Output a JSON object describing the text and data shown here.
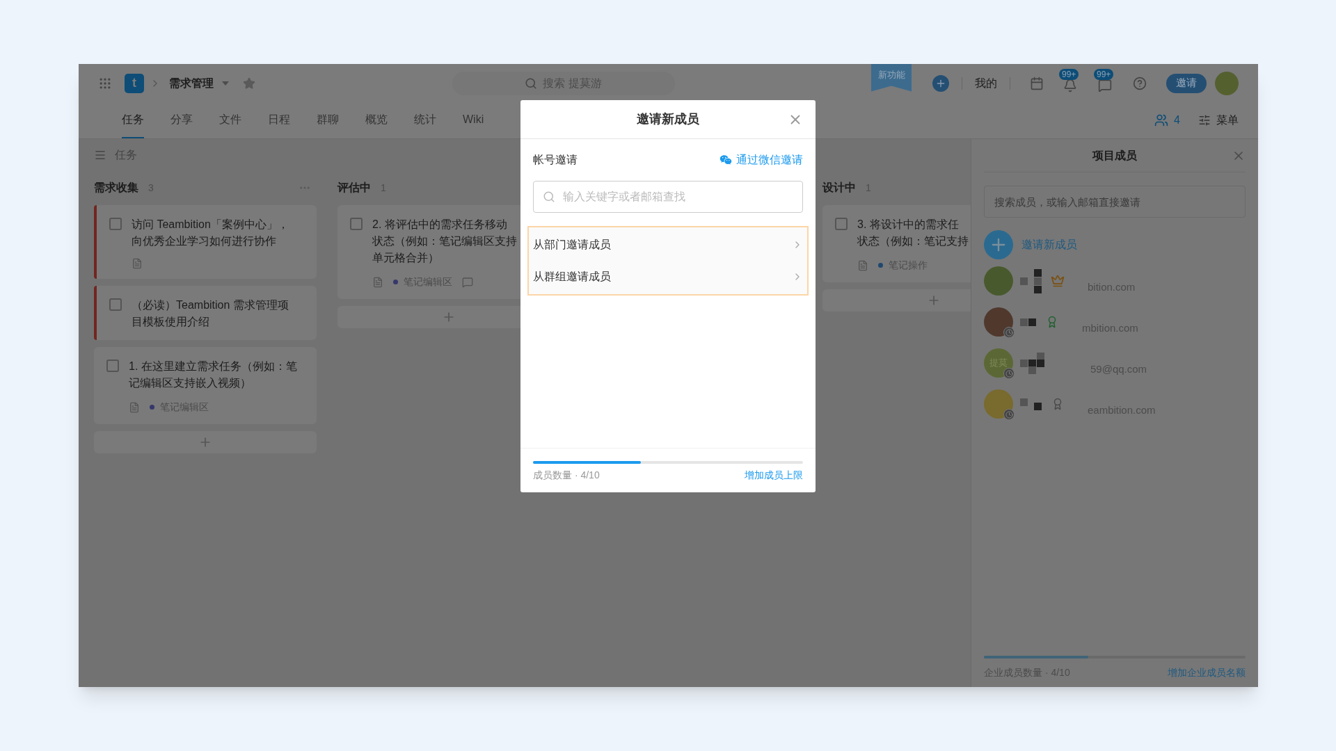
{
  "topbar": {
    "logo": "t",
    "project": "需求管理",
    "search": "搜索 提莫游",
    "new_feature": "新功能",
    "my": "我的",
    "badges": [
      "99+",
      "99+"
    ],
    "invite": "邀请"
  },
  "tabs": [
    {
      "label": "任务",
      "selected": true
    },
    {
      "label": "分享",
      "selected": false
    },
    {
      "label": "文件",
      "selected": false
    },
    {
      "label": "日程",
      "selected": false
    },
    {
      "label": "群聊",
      "selected": false
    },
    {
      "label": "概览",
      "selected": false
    },
    {
      "label": "统计",
      "selected": false
    },
    {
      "label": "Wiki",
      "selected": false
    }
  ],
  "toolbar_right": {
    "members_count": "4",
    "menu": "菜单"
  },
  "board": {
    "title": "任务",
    "columns": [
      {
        "name": "需求收集",
        "count": "3",
        "more": true,
        "cards": [
          {
            "lines": [
              "访问 Teambition「案例中心」，",
              "向优秀企业学习如何进行协作"
            ],
            "color": "#73241f",
            "checked": false,
            "note": true,
            "comment": false
          },
          {
            "lines": [
              "（必读）Teambition 需求管理项",
              "目模板使用介绍"
            ],
            "color": "#73241f",
            "checked": false,
            "note": false,
            "comment": false
          },
          {
            "lines": [
              "1. 在这里建立需求任务（例如：笔",
              "记编辑区支持嵌入视频）"
            ],
            "checked": false,
            "note": true,
            "comment": false,
            "tag": {
              "label": "笔记编辑区",
              "color": "#36386c"
            }
          }
        ]
      },
      {
        "name": "评估中",
        "count": "1",
        "more": false,
        "cards": [
          {
            "lines": [
              "2. 将评估中的需求任务移动",
              "状态（例如：笔记编辑区支持",
              "单元格合并）"
            ],
            "checked": false,
            "note": true,
            "comment": true,
            "tag": {
              "label": "笔记编辑区",
              "color": "#36386c"
            }
          }
        ]
      },
      {
        "name": "设计中",
        "count": "1",
        "more": false,
        "cards": [
          {
            "lines": [
              "3. 将设计中的需求任",
              "状态（例如：笔记支持"
            ],
            "checked": false,
            "note": true,
            "comment": false,
            "tag": {
              "label": "笔记操作",
              "color": "#1f4870"
            }
          }
        ]
      }
    ]
  },
  "modal": {
    "title": "邀请新成员",
    "section": "帐号邀请",
    "wechat_link": "通过微信邀请",
    "search_placeholder": "输入关键字或者邮箱查找",
    "options": [
      {
        "label": "从部门邀请成员"
      },
      {
        "label": "从群组邀请成员"
      }
    ],
    "usage": {
      "level": 0.4,
      "label": "成员数量 · 4/10",
      "link": "增加成员上限"
    }
  },
  "members_panel": {
    "title": "项目成员",
    "search_placeholder": "搜索成员，或输入邮箱直接邀请",
    "invite": "邀请新成员",
    "members": [
      {
        "kind": "picture",
        "color": "#485a2d",
        "role": {
          "kind": "crown"
        },
        "clock_badge": false,
        "email": "bition.com"
      },
      {
        "kind": "picture",
        "color": "#50382d",
        "role": {
          "kind": "ribbon_green"
        },
        "clock_badge": true,
        "email": "mbition.com"
      },
      {
        "kind": "initials",
        "initials": "提莫",
        "color": "#5b6835",
        "clock_badge": true,
        "email": "59@qq.com"
      },
      {
        "kind": "picture",
        "color": "#796a2d",
        "role": {
          "kind": "ribbon_grey"
        },
        "clock_badge": true,
        "email": "eambition.com"
      }
    ],
    "usage": {
      "level": 0.4,
      "label": "企业成员数量 · 4/10",
      "link": "增加企业成员名额"
    }
  }
}
